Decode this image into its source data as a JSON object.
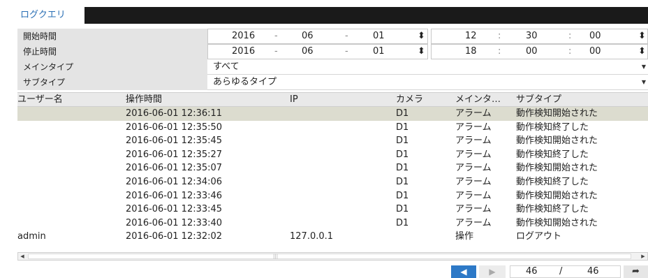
{
  "tab": {
    "label": "ログクエリ"
  },
  "filters": {
    "start": {
      "label": "開始時間",
      "year": "2016",
      "month": "06",
      "day": "01",
      "hour": "12",
      "minute": "30",
      "second": "00"
    },
    "stop": {
      "label": "停止時間",
      "year": "2016",
      "month": "06",
      "day": "01",
      "hour": "18",
      "minute": "00",
      "second": "00"
    },
    "main_type": {
      "label": "メインタイプ",
      "value": "すべて"
    },
    "sub_type": {
      "label": "サブタイプ",
      "value": "あらゆるタイプ"
    },
    "date_sep": "-",
    "time_sep": ":",
    "spin_icon": "⬍"
  },
  "table": {
    "headers": [
      "ユーザー名",
      "操作時間",
      "IP",
      "カメラ",
      "メインタ…",
      "サブタイプ"
    ],
    "rows": [
      [
        "",
        "2016-06-01 12:36:11",
        "",
        "D1",
        "アラーム",
        "動作検知開始された"
      ],
      [
        "",
        "2016-06-01 12:35:50",
        "",
        "D1",
        "アラーム",
        "動作検知終了した"
      ],
      [
        "",
        "2016-06-01 12:35:45",
        "",
        "D1",
        "アラーム",
        "動作検知開始された"
      ],
      [
        "",
        "2016-06-01 12:35:27",
        "",
        "D1",
        "アラーム",
        "動作検知終了した"
      ],
      [
        "",
        "2016-06-01 12:35:07",
        "",
        "D1",
        "アラーム",
        "動作検知開始された"
      ],
      [
        "",
        "2016-06-01 12:34:06",
        "",
        "D1",
        "アラーム",
        "動作検知終了した"
      ],
      [
        "",
        "2016-06-01 12:33:46",
        "",
        "D1",
        "アラーム",
        "動作検知開始された"
      ],
      [
        "",
        "2016-06-01 12:33:45",
        "",
        "D1",
        "アラーム",
        "動作検知終了した"
      ],
      [
        "",
        "2016-06-01 12:33:40",
        "",
        "D1",
        "アラーム",
        "動作検知開始された"
      ],
      [
        "admin",
        "2016-06-01 12:32:02",
        "127.0.0.1",
        "",
        "操作",
        "ログアウト"
      ]
    ]
  },
  "pager": {
    "current": "46",
    "separator": "/",
    "total": "46",
    "prev_icon": "◀",
    "next_icon": "▶",
    "go_icon": "➦"
  }
}
